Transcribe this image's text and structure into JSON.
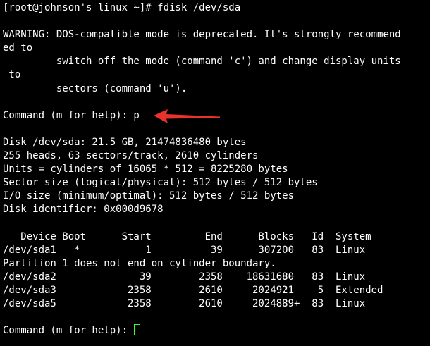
{
  "terminal": {
    "lines": [
      "[root@johnson's linux ~]# fdisk /dev/sda",
      "",
      "WARNING: DOS-compatible mode is deprecated. It's strongly recommend",
      "ed to",
      "         switch off the mode (command 'c') and change display units",
      " to",
      "         sectors (command 'u').",
      "",
      "Command (m for help): p",
      "",
      "Disk /dev/sda: 21.5 GB, 21474836480 bytes",
      "255 heads, 63 sectors/track, 2610 cylinders",
      "Units = cylinders of 16065 * 512 = 8225280 bytes",
      "Sector size (logical/physical): 512 bytes / 512 bytes",
      "I/O size (minimum/optimal): 512 bytes / 512 bytes",
      "Disk identifier: 0x000d9678",
      "",
      "   Device Boot      Start         End      Blocks   Id  System",
      "/dev/sda1   *           1          39      307200   83  Linux",
      "Partition 1 does not end on cylinder boundary.",
      "/dev/sda2              39        2358    18631680   83  Linux",
      "/dev/sda3            2358        2610     2024921    5  Extended",
      "/dev/sda5            2358        2610     2024889+  83  Linux",
      "",
      "Command (m for help): "
    ]
  },
  "colors": {
    "background": "#000000",
    "text": "#ffffff",
    "cursor": "#33ff33",
    "annotation_arrow": "#e8322c"
  },
  "icons": {
    "annotation": "red-arrow-icon"
  }
}
